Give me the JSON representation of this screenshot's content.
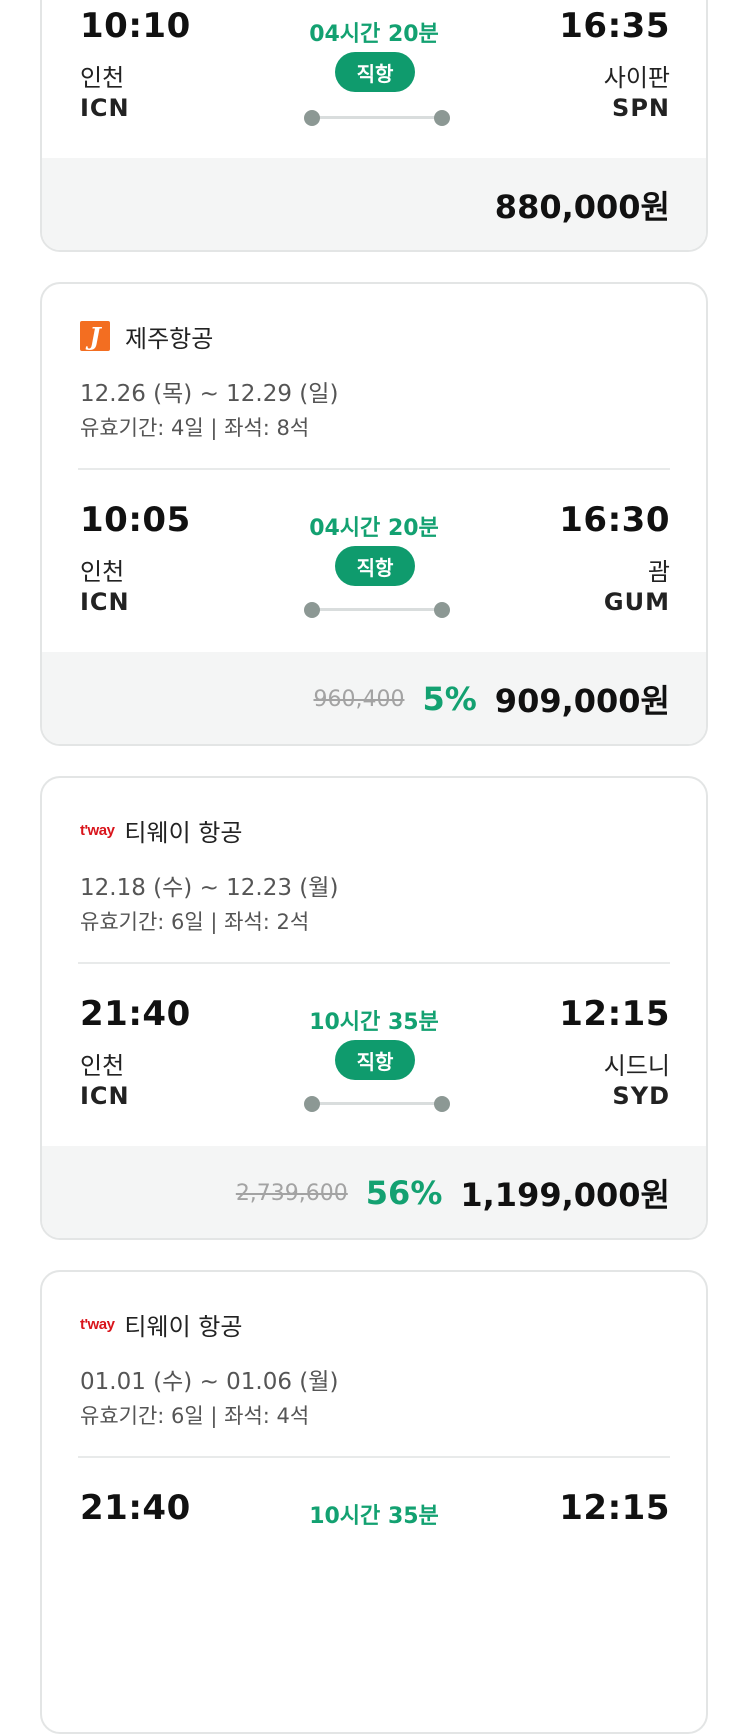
{
  "cards": [
    {
      "depart": {
        "time": "10:10",
        "city": "인천",
        "code": "ICN"
      },
      "duration": "04시간 20분",
      "direct": "직항",
      "arrive": {
        "time": "16:35",
        "city": "사이판",
        "code": "SPN"
      },
      "price": "880,000원"
    },
    {
      "airline": "제주항공",
      "logo_text": "J",
      "dates": "12.26 (목) ~ 12.29 (일)",
      "validity": "유효기간: 4일 | 좌석: 8석",
      "depart": {
        "time": "10:05",
        "city": "인천",
        "code": "ICN"
      },
      "duration": "04시간 20분",
      "direct": "직항",
      "arrive": {
        "time": "16:30",
        "city": "괌",
        "code": "GUM"
      },
      "original_price": "960,400",
      "discount": "5%",
      "price": "909,000원"
    },
    {
      "airline": "티웨이 항공",
      "logo_text": "t'way",
      "dates": "12.18 (수) ~ 12.23 (월)",
      "validity": "유효기간: 6일 | 좌석: 2석",
      "depart": {
        "time": "21:40",
        "city": "인천",
        "code": "ICN"
      },
      "duration": "10시간 35분",
      "direct": "직항",
      "arrive": {
        "time": "12:15",
        "city": "시드니",
        "code": "SYD"
      },
      "original_price": "2,739,600",
      "discount": "56%",
      "price": "1,199,000원"
    },
    {
      "airline": "티웨이 항공",
      "logo_text": "t'way",
      "dates": "01.01 (수) ~ 01.06 (월)",
      "validity": "유효기간: 6일 | 좌석: 4석",
      "depart": {
        "time": "21:40"
      },
      "duration": "10시간 35분",
      "arrive": {
        "time": "12:15"
      }
    }
  ]
}
